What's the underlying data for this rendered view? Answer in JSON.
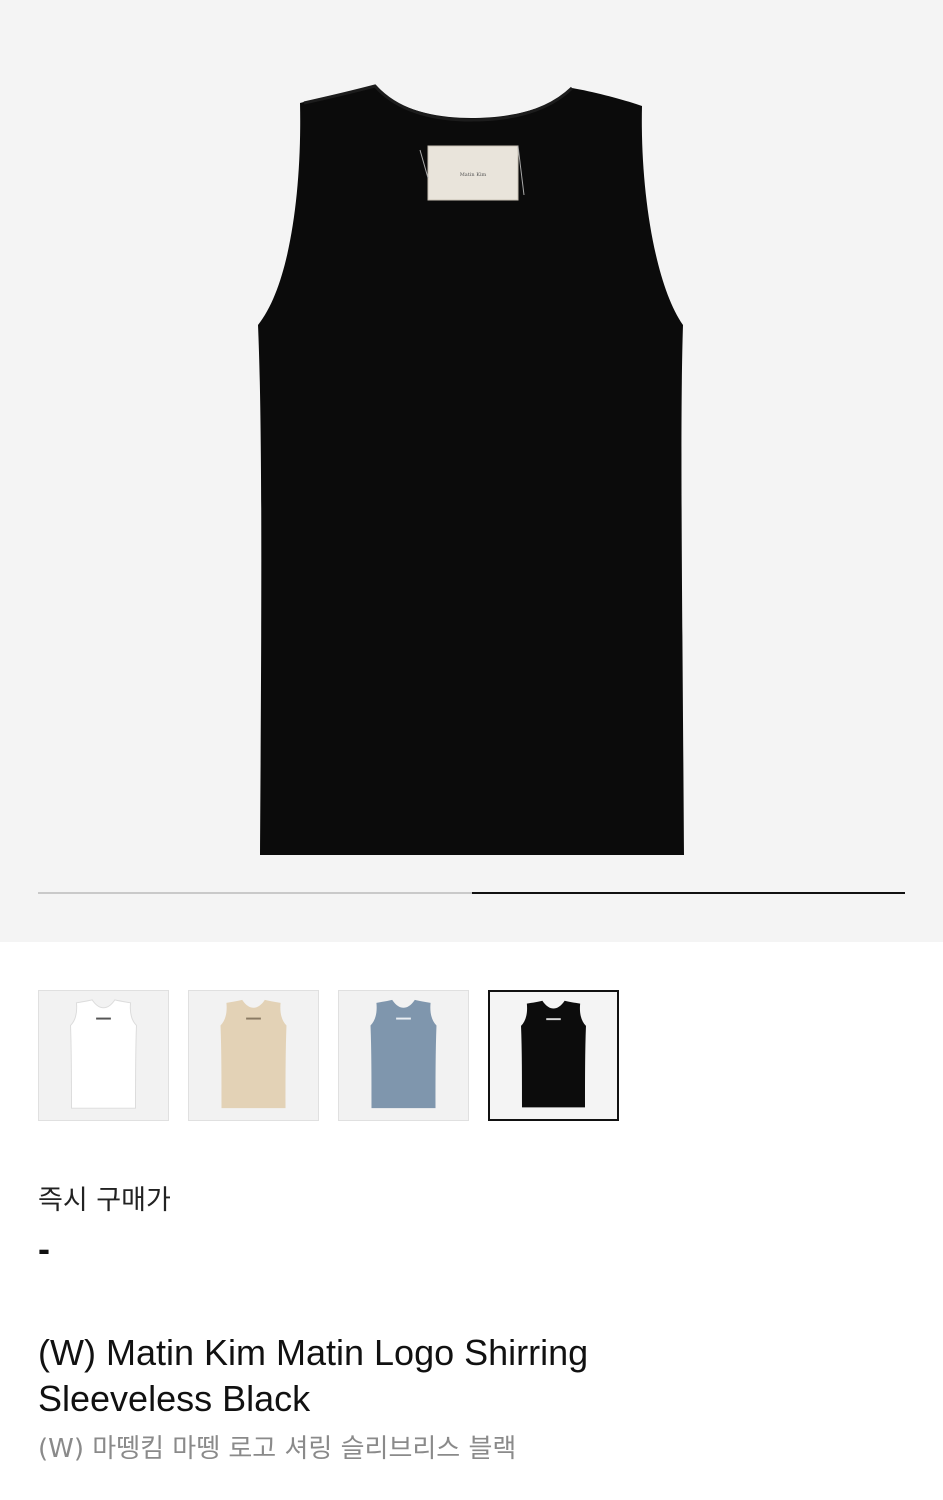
{
  "gallery": {
    "main_image": "black sleeveless tank top (back view)",
    "progress": 0.5
  },
  "thumbnails": [
    {
      "color": "#ffffff",
      "label_color": "#555555",
      "selected": false
    },
    {
      "color": "#e3d2b6",
      "label_color": "#8a7a63",
      "selected": false
    },
    {
      "color": "#7f96ad",
      "label_color": "#e9eef3",
      "selected": false
    },
    {
      "color": "#0c0c0c",
      "label_color": "#d8d8d8",
      "selected": true
    }
  ],
  "price": {
    "label": "즉시 구매가",
    "value": "-"
  },
  "product": {
    "title": "(W) Matin Kim Matin Logo Shirring Sleeveless Black",
    "title_ko": "(W) 마뗑킴 마뗑 로고 셔링 슬리브리스 블랙"
  }
}
